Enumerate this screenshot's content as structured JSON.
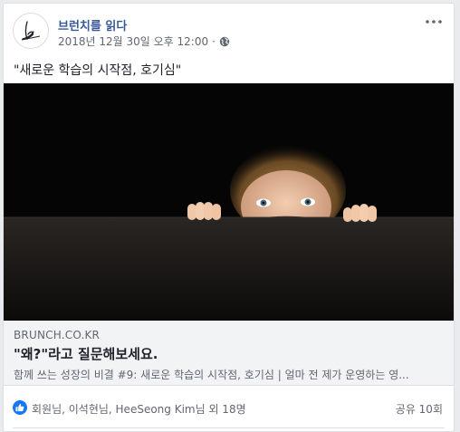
{
  "post": {
    "page_name": "브런치를 읽다",
    "timestamp": "2018년 12월 30일 오후 12:00",
    "separator": "·",
    "privacy_icon": "globe-icon",
    "more_icon": "more-options-icon",
    "text": "\"새로운 학습의 시작점, 호기심\""
  },
  "link_preview": {
    "domain": "BRUNCH.CO.KR",
    "title": "\"왜?\"라고 질문해보세요.",
    "description": "함께 쓰는 성장의 비결 #9: 새로운 학습의 시작점, 호기심 | 얼마 전 제가 운영하는 영..."
  },
  "reactions": {
    "icon": "like-icon",
    "likers_text": "회원님, 이석현님, HeeSeong Kim님 외 18명",
    "shares_text": "공유 10회"
  },
  "colors": {
    "link_blue": "#385898",
    "like_blue": "#1877f2",
    "muted_text": "#616770"
  }
}
